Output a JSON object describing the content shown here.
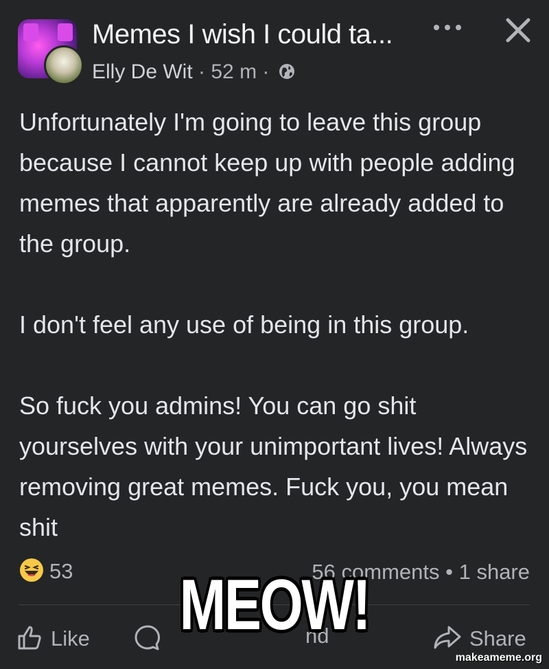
{
  "header": {
    "group_title": "Memes I wish I could ta...",
    "author": "Elly De Wit",
    "separator1": " · ",
    "time": "52 m",
    "separator2": " · "
  },
  "post": {
    "paragraphs": [
      "Unfortunately I'm going to leave this group because I cannot keep up with people adding memes that apparently are already added to the group.",
      "I don't feel any use of being in this group.",
      "So fuck you admins! You can go shit yourselves with your unimportant lives! Always removing great memes. Fuck you, you mean shit"
    ]
  },
  "engagement": {
    "reaction_count": "53",
    "comments": "56 comments",
    "dot": " • ",
    "shares": "1 share"
  },
  "actions": {
    "like": "Like",
    "send": "nd",
    "share": "Share"
  },
  "overlay": {
    "caption": "MEOW!",
    "watermark": "makeameme.org"
  },
  "icons": {
    "more": "more-horizontal-icon",
    "close": "close-icon",
    "privacy": "globe-icon",
    "reaction": "haha-emoji-icon",
    "like": "thumbs-up-icon",
    "comment": "comment-bubble-icon",
    "share": "share-arrow-icon"
  },
  "colors": {
    "background": "#242526",
    "primary_text": "#e4e6eb",
    "secondary_text": "#b0b3b8",
    "haha_yellow": "#f7c94a"
  }
}
